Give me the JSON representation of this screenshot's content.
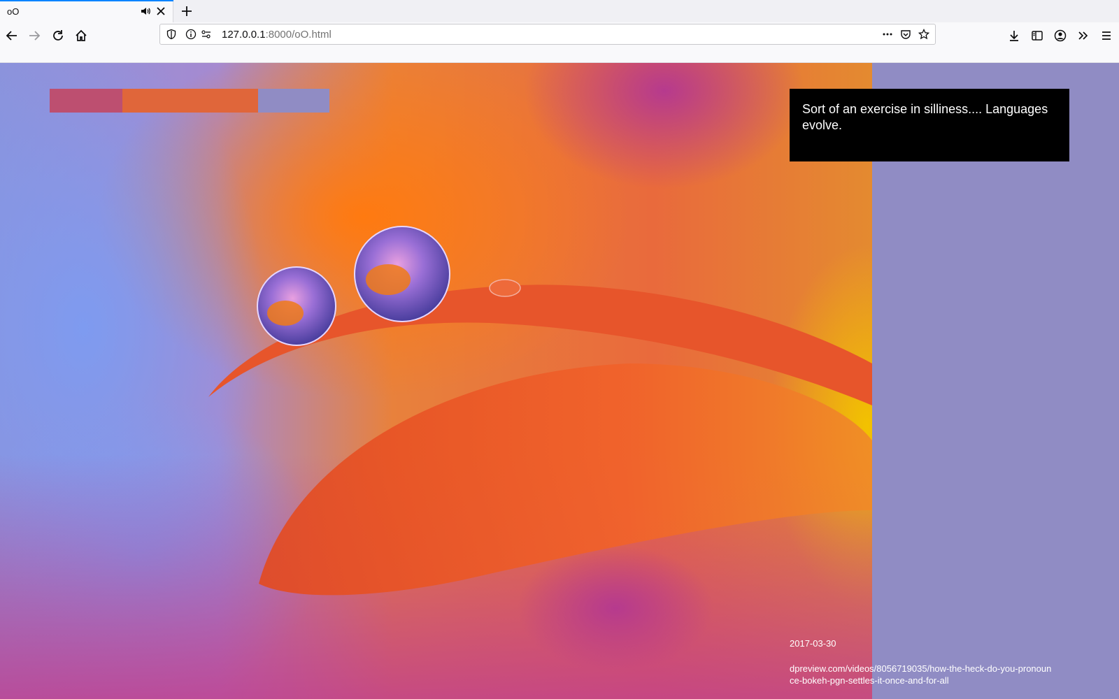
{
  "browser": {
    "tab": {
      "title": "oO"
    },
    "url": {
      "host": "127.0.0.1",
      "rest": ":8000/oO.html"
    },
    "icons": {
      "back": "back-arrow-icon",
      "forward": "forward-arrow-icon",
      "reload": "reload-icon",
      "home": "home-icon",
      "shield": "tracking-protection-shield-icon",
      "info": "site-info-icon",
      "permissions": "permissions-icon",
      "more": "page-actions-more-icon",
      "pocket": "pocket-icon",
      "bookmark": "bookmark-star-icon",
      "downloads": "downloads-icon",
      "sidebar": "sidebar-icon",
      "account": "account-icon",
      "overflow": "overflow-chevron-icon",
      "menu": "hamburger-menu-icon",
      "audio": "speaker-icon",
      "close": "close-icon",
      "newtab": "plus-icon"
    }
  },
  "page": {
    "palette": [
      "#bd4f70",
      "#e0663a",
      "#908cc4"
    ],
    "quote": "Sort of an exercise in silliness.... Languages evolve.",
    "date": "2017-03-30",
    "source": "dpreview.com/videos/8056719035/how-the-heck-do-you-pronounce-bokeh-pgn-settles-it-once-and-for-all",
    "panel_color": "#908cc4",
    "quote_bg": "#000000"
  }
}
